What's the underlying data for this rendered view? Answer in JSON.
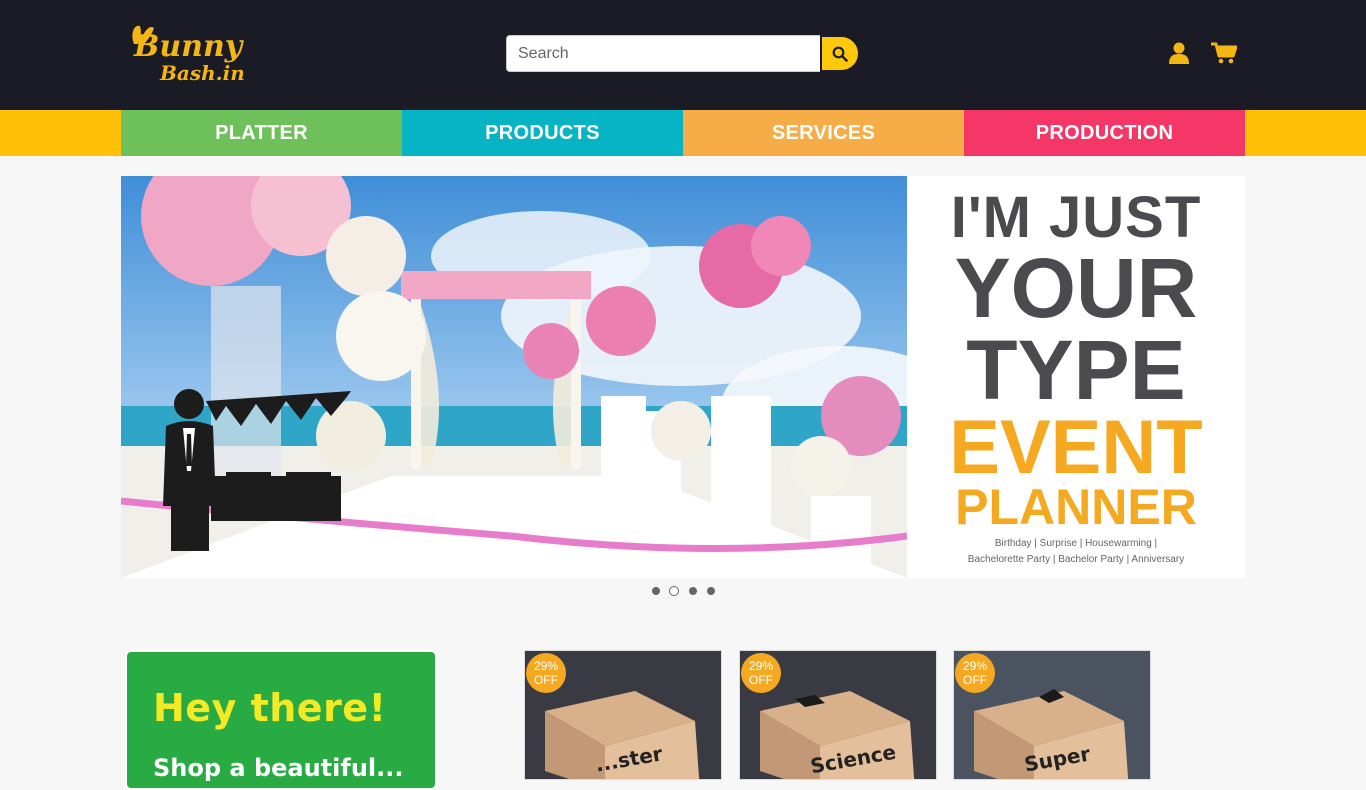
{
  "brand": {
    "logo_line1": "Bunny",
    "logo_line2": "Bash.in"
  },
  "search": {
    "placeholder": "Search"
  },
  "header_icons": [
    "user-icon",
    "cart-icon",
    "search-icon"
  ],
  "nav": {
    "items": [
      {
        "label": "PLATTER",
        "color": "#6dc05a"
      },
      {
        "label": "PRODUCTS",
        "color": "#07b4c3"
      },
      {
        "label": "SERVICES",
        "color": "#f7ad47"
      },
      {
        "label": "PRODUCTION",
        "color": "#f43766"
      }
    ]
  },
  "banner": {
    "line1": "I'M JUST",
    "line2": "YOUR",
    "line3": "TYPE",
    "line4": "EVENT",
    "line5": "PLANNER",
    "caption1": "Birthday | Surprise | Housewarming |",
    "caption2": "Bachelorette Party | Bachelor Party | Anniversary",
    "slides_total": 4,
    "active_slide": 2
  },
  "promo": {
    "title": "Hey there!",
    "subtitle": "Shop a beautiful..."
  },
  "products": [
    {
      "badge_percent": "29%",
      "badge_off": "OFF",
      "label": "...ster"
    },
    {
      "badge_percent": "29%",
      "badge_off": "OFF",
      "label": "Science"
    },
    {
      "badge_percent": "29%",
      "badge_off": "OFF",
      "label": "Super"
    }
  ],
  "colors": {
    "header_bg": "#1a1b25",
    "accent": "#ffc80a",
    "promo_green": "#29ab43"
  }
}
